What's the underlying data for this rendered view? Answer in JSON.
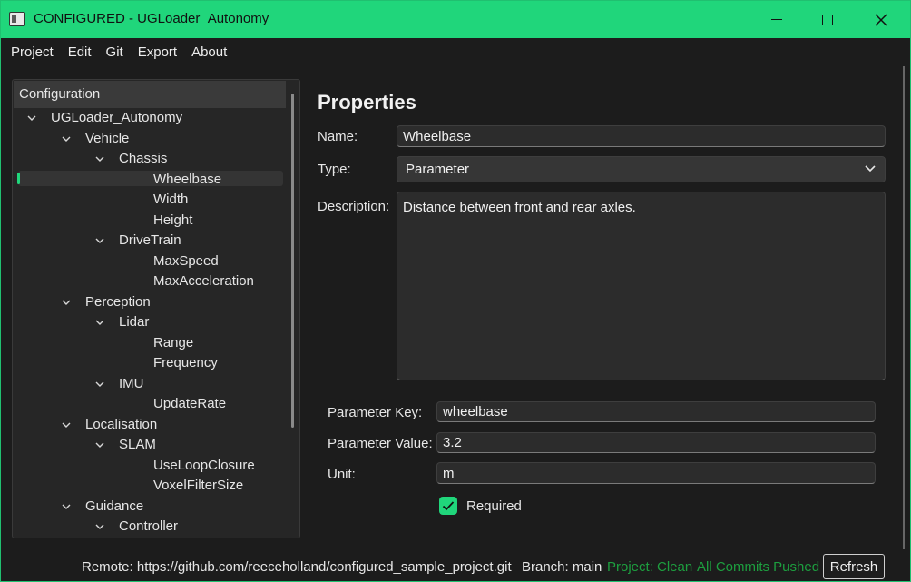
{
  "window": {
    "title": "CONFIGURED - UGLoader_Autonomy",
    "accent": "#20d67b"
  },
  "menu": [
    "Project",
    "Edit",
    "Git",
    "Export",
    "About"
  ],
  "tree": {
    "header": "Configuration",
    "nodes": [
      {
        "label": "UGLoader_Autonomy",
        "level": 0,
        "expanded": true
      },
      {
        "label": "Vehicle",
        "level": 1,
        "expanded": true
      },
      {
        "label": "Chassis",
        "level": 2,
        "expanded": true
      },
      {
        "label": "Wheelbase",
        "level": 3,
        "selected": true
      },
      {
        "label": "Width",
        "level": 3
      },
      {
        "label": "Height",
        "level": 3
      },
      {
        "label": "DriveTrain",
        "level": 2,
        "expanded": true
      },
      {
        "label": "MaxSpeed",
        "level": 3
      },
      {
        "label": "MaxAcceleration",
        "level": 3
      },
      {
        "label": "Perception",
        "level": 1,
        "expanded": true
      },
      {
        "label": "Lidar",
        "level": 2,
        "expanded": true
      },
      {
        "label": "Range",
        "level": 3
      },
      {
        "label": "Frequency",
        "level": 3
      },
      {
        "label": "IMU",
        "level": 2,
        "expanded": true
      },
      {
        "label": "UpdateRate",
        "level": 3
      },
      {
        "label": "Localisation",
        "level": 1,
        "expanded": true
      },
      {
        "label": "SLAM",
        "level": 2,
        "expanded": true
      },
      {
        "label": "UseLoopClosure",
        "level": 3
      },
      {
        "label": "VoxelFilterSize",
        "level": 3
      },
      {
        "label": "Guidance",
        "level": 1,
        "expanded": true
      },
      {
        "label": "Controller",
        "level": 2,
        "expanded": true
      }
    ]
  },
  "properties": {
    "title": "Properties",
    "name_label": "Name:",
    "name_value": "Wheelbase",
    "type_label": "Type:",
    "type_value": "Parameter",
    "description_label": "Description:",
    "description_value": "Distance between front and rear axles.",
    "param_key_label": "Parameter Key:",
    "param_key_value": "wheelbase",
    "param_value_label": "Parameter Value:",
    "param_value_value": "3.2",
    "unit_label": "Unit:",
    "unit_value": "m",
    "required_label": "Required",
    "required_checked": true
  },
  "status": {
    "remote": "Remote: https://github.com/reeceholland/configured_sample_project.git",
    "branch": "Branch: main",
    "project_state": "Project: Clean",
    "commits_state": "All Commits Pushed",
    "refresh_label": "Refresh",
    "ok_color": "#1d9f3f"
  }
}
